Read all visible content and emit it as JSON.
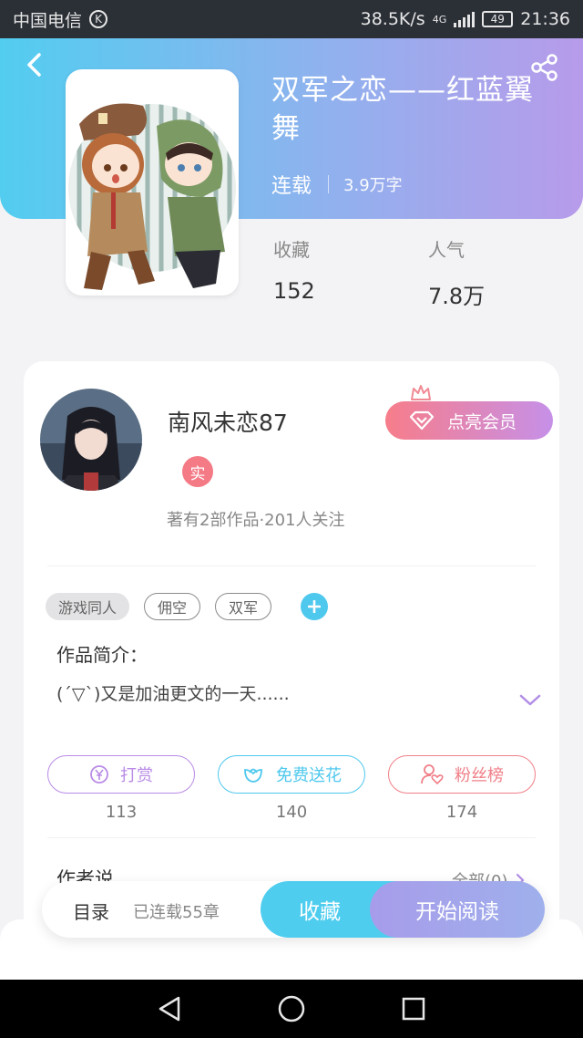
{
  "status_bar": {
    "carrier": "中国电信",
    "carrier_badge": "K",
    "net_speed": "38.5K/s",
    "network": "4G",
    "battery": "49",
    "time": "21:36"
  },
  "book": {
    "title": "双军之恋——红蓝翼舞",
    "status": "连载",
    "word_count": "3.9万字",
    "stats": [
      {
        "label": "收藏",
        "value": "152"
      },
      {
        "label": "人气",
        "value": "7.8万"
      }
    ]
  },
  "author": {
    "name": "南风未恋87",
    "badge": "实",
    "summary": "著有2部作品·201人关注",
    "vip_button": "点亮会员"
  },
  "tags": [
    "游戏同人",
    "佣空",
    "双军"
  ],
  "intro": {
    "heading": "作品简介：",
    "text": "(´▽`)又是加油更文的一天......"
  },
  "actions": [
    {
      "label": "打赏",
      "count": "113",
      "color": "#b98be6"
    },
    {
      "label": "免费送花",
      "count": "140",
      "color": "#4fc8ee"
    },
    {
      "label": "粉丝榜",
      "count": "174",
      "color": "#f07f88"
    }
  ],
  "author_says": {
    "heading": "作者说",
    "all_link": "全部(0)"
  },
  "bottom_bar": {
    "toc": "目录",
    "chapters": "已连载55章",
    "collect": "收藏",
    "read": "开始阅读"
  },
  "colors": {
    "header_start": "#52cdf0",
    "header_end": "#b79bea",
    "accent_blue": "#4fcdef",
    "accent_pink": "#f47a86"
  }
}
